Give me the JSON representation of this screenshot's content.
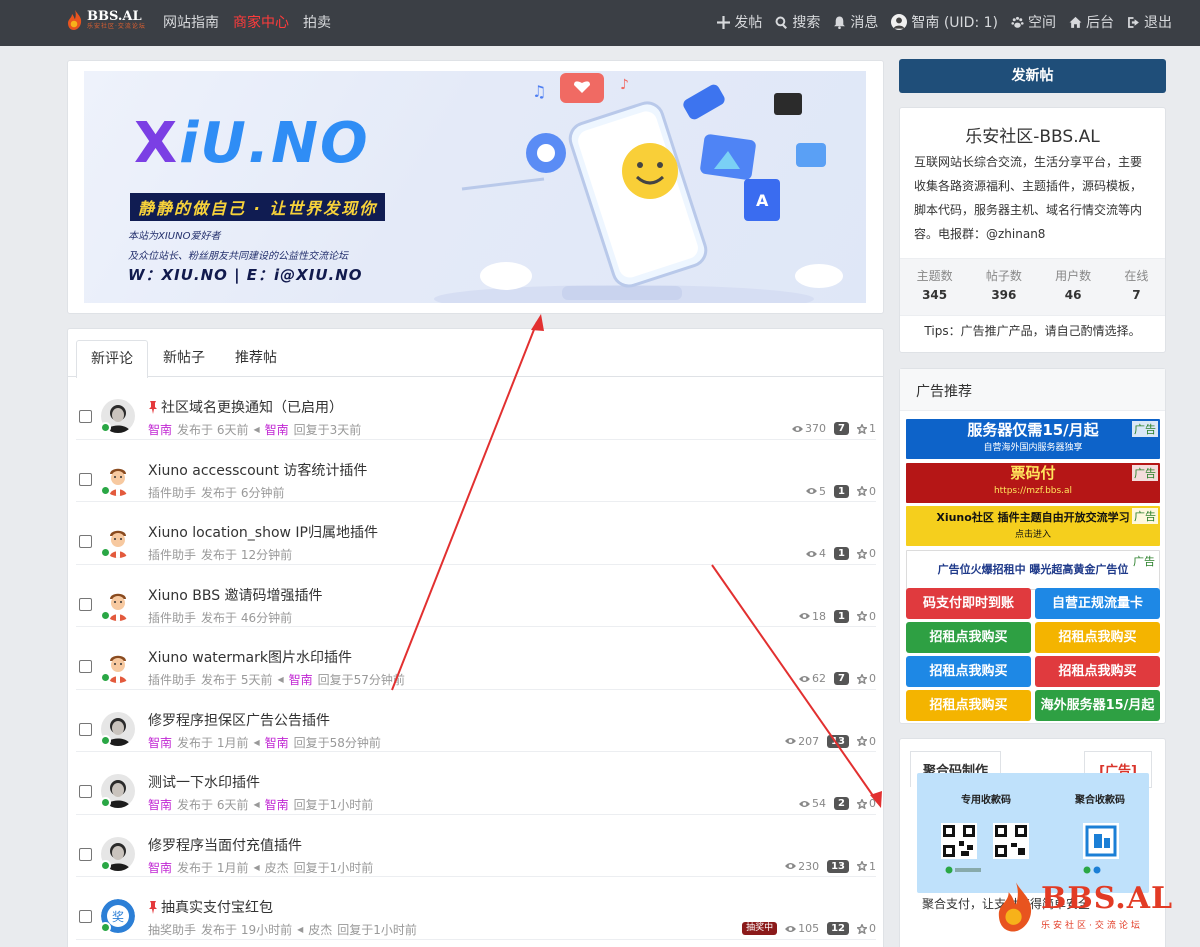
{
  "logo": {
    "name": "BBS.AL",
    "sub": "乐安社区·交流论坛"
  },
  "nav": {
    "left": [
      "网站指南",
      "商家中心",
      "拍卖"
    ],
    "right": {
      "post": "发帖",
      "search": "搜索",
      "messages": "消息",
      "user": "智南 (UID: 1)",
      "space": "空间",
      "admin": "后台",
      "logout": "退出"
    }
  },
  "banner": {
    "logo_x": "X",
    "logo_rest": "iU.NO",
    "slogan": "静静的做自己 · 让世界发现你",
    "line1": "本站为XIUNO爱好者",
    "line2": "及众位站长、粉丝朋友共同建设的公益性交流论坛",
    "contact": "W：XIU.NO | E：i@XIU.NO"
  },
  "tabs": [
    "新评论",
    "新帖子",
    "推荐帖"
  ],
  "threads": [
    {
      "pinned": true,
      "title": "社区域名更换通知（已启用）",
      "author": "智南",
      "author_admin": true,
      "posted": "发布于 6天前",
      "replier": "智南",
      "replier_admin": true,
      "replied": "回复于3天前",
      "views": "370",
      "count": "7",
      "stars": "1",
      "avatar": "photo"
    },
    {
      "pinned": false,
      "title": "Xiuno accesscount 访客统计插件",
      "author": "插件助手",
      "author_admin": false,
      "posted": "发布于 6分钟前",
      "replier": "",
      "replier_admin": false,
      "replied": "",
      "views": "5",
      "count": "1",
      "stars": "0",
      "avatar": "cartoon"
    },
    {
      "pinned": false,
      "title": "Xiuno location_show IP归属地插件",
      "author": "插件助手",
      "author_admin": false,
      "posted": "发布于 12分钟前",
      "replier": "",
      "replier_admin": false,
      "replied": "",
      "views": "4",
      "count": "1",
      "stars": "0",
      "avatar": "cartoon"
    },
    {
      "pinned": false,
      "title": "Xiuno BBS 邀请码增强插件",
      "author": "插件助手",
      "author_admin": false,
      "posted": "发布于 46分钟前",
      "replier": "",
      "replier_admin": false,
      "replied": "",
      "views": "18",
      "count": "1",
      "stars": "0",
      "avatar": "cartoon"
    },
    {
      "pinned": false,
      "title": "Xiuno watermark图片水印插件",
      "author": "插件助手",
      "author_admin": false,
      "posted": "发布于 5天前",
      "replier": "智南",
      "replier_admin": true,
      "replied": "回复于57分钟前",
      "views": "62",
      "count": "7",
      "stars": "0",
      "avatar": "cartoon"
    },
    {
      "pinned": false,
      "title": "修罗程序担保区广告公告插件",
      "author": "智南",
      "author_admin": true,
      "posted": "发布于 1月前",
      "replier": "智南",
      "replier_admin": true,
      "replied": "回复于58分钟前",
      "views": "207",
      "count": "13",
      "stars": "0",
      "avatar": "photo"
    },
    {
      "pinned": false,
      "title": "测试一下水印插件",
      "author": "智南",
      "author_admin": true,
      "posted": "发布于 6天前",
      "replier": "智南",
      "replier_admin": true,
      "replied": "回复于1小时前",
      "views": "54",
      "count": "2",
      "stars": "0",
      "avatar": "photo"
    },
    {
      "pinned": false,
      "title": "修罗程序当面付充值插件",
      "author": "智南",
      "author_admin": true,
      "posted": "发布于 1月前",
      "replier": "皮杰",
      "replier_admin": false,
      "replied": "回复于1小时前",
      "views": "230",
      "count": "13",
      "stars": "1",
      "avatar": "photo"
    },
    {
      "pinned": true,
      "title": "抽真实支付宝红包",
      "author": "抽奖助手",
      "author_admin": false,
      "posted": "发布于 19小时前",
      "replier": "皮杰",
      "replier_admin": false,
      "replied": "回复于1小时前",
      "views": "105",
      "count": "12",
      "stars": "0",
      "avatar": "lottery",
      "badge": "抽奖中"
    }
  ],
  "sidebar": {
    "new_post": "发新帖",
    "site_title": "乐安社区-BBS.AL",
    "site_desc": "互联网站长综合交流，生活分享平台，主要收集各路资源福利、主题插件，源码模板，脚本代码，服务器主机、域名行情交流等内容。电报群：@zhinan8",
    "stats": [
      {
        "label": "主题数",
        "value": "345"
      },
      {
        "label": "帖子数",
        "value": "396"
      },
      {
        "label": "用户数",
        "value": "46"
      },
      {
        "label": "在线",
        "value": "7"
      }
    ],
    "tips": "Tips：广告推广产品，请自己酌情选择。",
    "ad_title": "广告推荐",
    "ad_tag": "广告",
    "ad_banners": [
      {
        "text": "服务器仅需15/月起",
        "sub": "自营海外国内服务器独享",
        "bg": "#0d63c9",
        "fg": "#ffffff"
      },
      {
        "text": "票码付",
        "sub": "https://mzf.bbs.al",
        "bg": "#b51616",
        "fg": "#ffe55c"
      },
      {
        "text": "Xiuno社区 插件主题自由开放交流学习",
        "sub": "点击进入",
        "bg": "#f5cf1d",
        "fg": "#111111"
      },
      {
        "text": "广告位火爆招租中  曝光超高黄金广告位",
        "sub": "",
        "bg": "#ffffff",
        "fg": "#1f3a8a"
      }
    ],
    "ad_buttons": [
      {
        "label": "码支付即时到账",
        "color": "#e03a3e"
      },
      {
        "label": "自营正规流量卡",
        "color": "#1e88e5"
      },
      {
        "label": "招租点我购买",
        "color": "#2ea043"
      },
      {
        "label": "招租点我购买",
        "color": "#f4b400"
      },
      {
        "label": "招租点我购买",
        "color": "#1e88e5"
      },
      {
        "label": "招租点我购买",
        "color": "#e03a3e"
      },
      {
        "label": "招租点我购买",
        "color": "#f4b400"
      },
      {
        "label": "海外服务器15/月起",
        "color": "#2ea043"
      }
    ],
    "qr_tab": "聚合码制作",
    "qr_ad": "[广告]",
    "qr_label_left": "专用收款码",
    "qr_label_right": "聚合收款码",
    "qr_bottom": "聚合支付，让支付变得简单安全"
  },
  "watermark": {
    "text": "BBS.AL",
    "sub": "乐安社区·交流论坛"
  },
  "colors": {
    "topbar": "#3b3f45",
    "accent_red": "#ff3b3b",
    "admin_purple": "#c026d3",
    "primary": "#1f4e79",
    "online": "#2aa745"
  }
}
